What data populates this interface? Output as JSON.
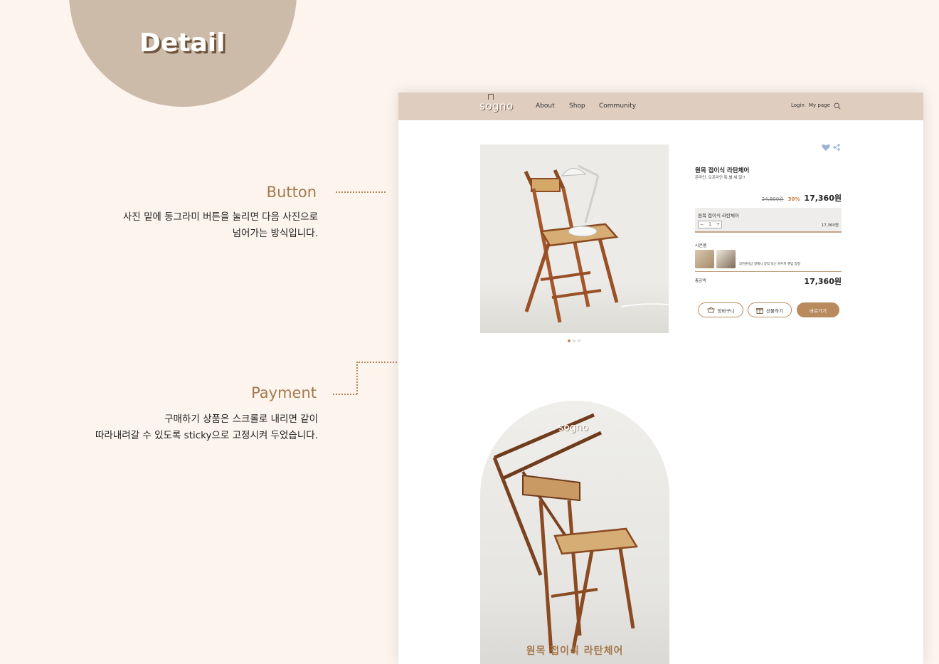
{
  "section": {
    "title": "Detail"
  },
  "annotations": [
    {
      "title": "Button",
      "lines": [
        "사진 밑에 동그라미 버튼을 눌리면 다음 사진으로",
        "넘어가는 방식입니다."
      ]
    },
    {
      "title": "Payment",
      "lines": [
        "구매하기 상품은 스크롤로 내리면 같이",
        "따라내려갈 수 있도록 sticky으로 고정시켜 두었습니다."
      ]
    }
  ],
  "header": {
    "logo": "sogno",
    "nav": [
      "About",
      "Shop",
      "Community"
    ],
    "login": "Login",
    "mypage": "My page",
    "search_icon": "search-icon"
  },
  "gallery": {
    "page_count": 3,
    "active_page": 1
  },
  "product": {
    "name": "원목 접이식 라탄체어",
    "subtitle": "온라인, 오프라인 특.별.세.일!!",
    "original_price": "24,800원",
    "discount": "30%",
    "price": "17,360원",
    "option_name": "원목 접이식 라탄체어",
    "quantity": "1",
    "option_price": "17,360원",
    "gift_label": "사은품",
    "gift_text": "5만원이상 결제시 양악 또는 파우치 랜덤 증정",
    "total_label": "총금액",
    "total_price": "17,360원"
  },
  "buttons": {
    "cart": "장바구니",
    "gift": "선물하기",
    "buy": "바로가기"
  },
  "banner": {
    "logo": "sogno",
    "caption": "원목 접이식 라탄체어"
  },
  "colors": {
    "accent": "#b98a5e",
    "nav_bg": "#dfcdbf",
    "page_bg": "#fdf4ee",
    "heart": "#9bb4d4"
  }
}
